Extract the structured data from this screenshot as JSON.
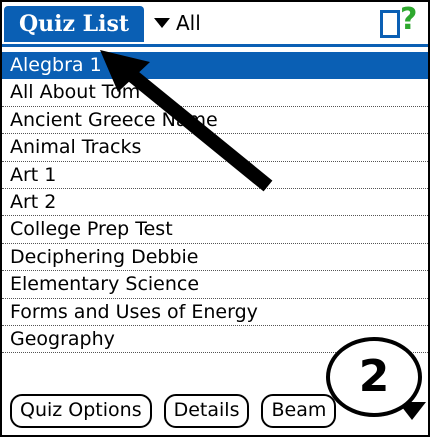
{
  "header": {
    "title": "Quiz List",
    "category_filter": "All",
    "icons": [
      "battery-icon",
      "help-icon"
    ],
    "colors": {
      "accent": "#0a5fb4",
      "help": "#2ea82e"
    }
  },
  "quizzes": [
    "Alegbra 1",
    "All About Tom",
    "Ancient Greece Name",
    "Animal Tracks",
    "Art 1",
    "Art 2",
    "College Prep Test",
    "Deciphering Debbie",
    "Elementary Science",
    "Forms and Uses of Energy",
    "Geography"
  ],
  "selected_index": 0,
  "buttons": {
    "quiz_options": "Quiz Options",
    "details": "Details",
    "beam": "Beam"
  },
  "annotation": {
    "step_number": "2"
  }
}
